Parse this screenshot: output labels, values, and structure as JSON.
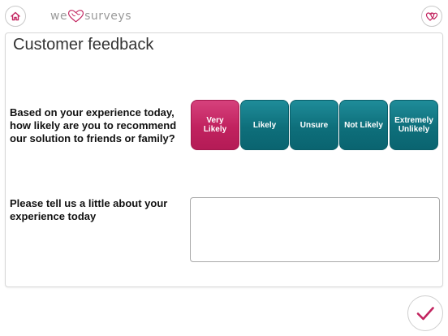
{
  "header": {
    "logo_word_1": "we",
    "logo_word_2": "surveys",
    "home_icon": "home-icon",
    "feedback_icon": "hearts-icon"
  },
  "page": {
    "title": "Customer feedback"
  },
  "question1": {
    "text": "Based on your experience today, how likely are you to recommend our solution to friends or family?",
    "options": [
      "Very Likely",
      "Likely",
      "Unsure",
      "Not Likely",
      "Extremely Unlikely"
    ],
    "selected_index": 0
  },
  "question2": {
    "text": "Please tell us a little about your experience today",
    "value": "",
    "placeholder": ""
  },
  "colors": {
    "accent_pink": "#c1225f",
    "accent_teal": "#0e6f7b"
  },
  "submit": {
    "icon": "checkmark-icon"
  }
}
